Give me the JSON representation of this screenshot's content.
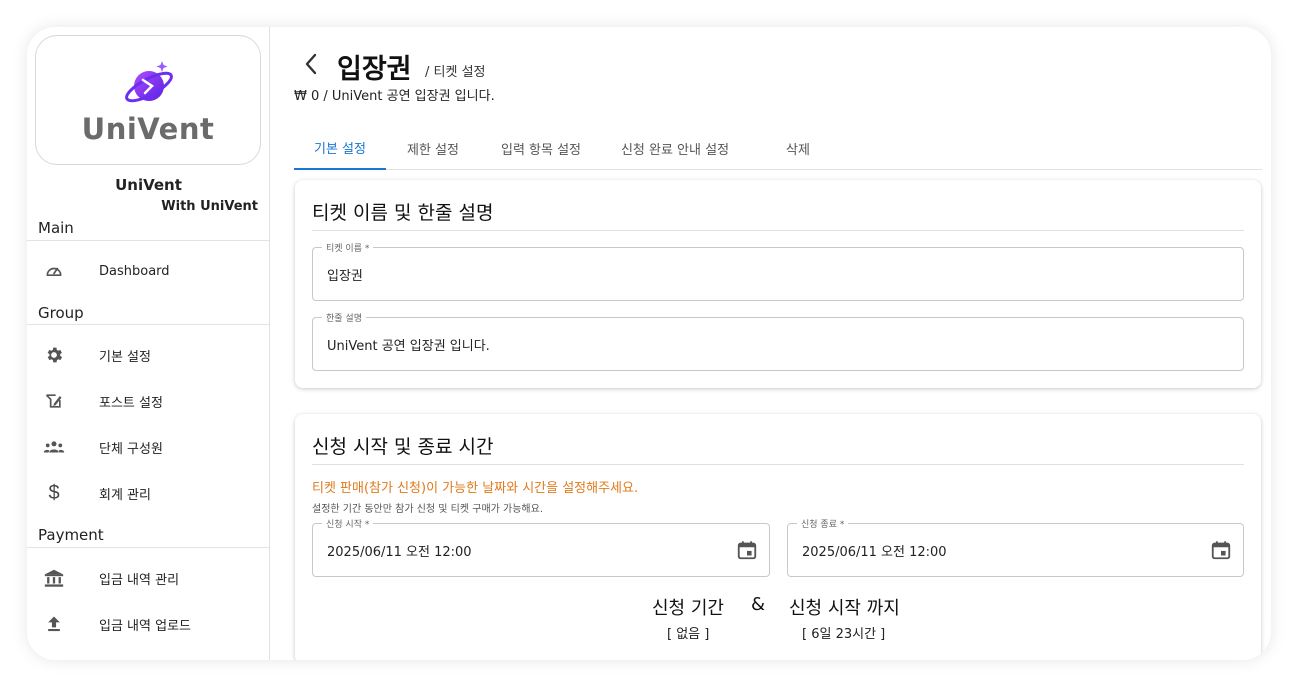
{
  "brand": {
    "logo_text": "UniVent",
    "name": "UniVent",
    "sub": "With UniVent"
  },
  "sidebar": {
    "sections": [
      {
        "label": "Main"
      },
      {
        "label": "Group"
      },
      {
        "label": "Payment"
      }
    ],
    "items": [
      {
        "label": "Dashboard",
        "icon": "speedometer-icon"
      },
      {
        "label": "기본 설정",
        "icon": "gear-icon"
      },
      {
        "label": "포스트 설정",
        "icon": "post-edit-icon"
      },
      {
        "label": "단체 구성원",
        "icon": "group-icon"
      },
      {
        "label": "회계 관리",
        "icon": "dollar-icon"
      },
      {
        "label": "입금 내역 관리",
        "icon": "bank-icon"
      },
      {
        "label": "입금 내역 업로드",
        "icon": "upload-icon"
      }
    ]
  },
  "header": {
    "title": "입장권",
    "subtitle": "/ 티켓 설정",
    "description": "₩ 0 / UniVent 공연 입장권 입니다."
  },
  "tabs": [
    {
      "label": "기본 설정",
      "active": true
    },
    {
      "label": "제한 설정",
      "active": false
    },
    {
      "label": "입력 항목 설정",
      "active": false
    },
    {
      "label": "신청 완료 안내 설정",
      "active": false
    },
    {
      "label": "삭제",
      "active": false
    }
  ],
  "card_name": {
    "title": "티켓 이름 및 한줄 설명",
    "name_field": {
      "label": "티켓 이름 *",
      "value": "입장권"
    },
    "desc_field": {
      "label": "한줄 설명",
      "value": "UniVent 공연 입장권 입니다."
    }
  },
  "card_time": {
    "title": "신청 시작 및 종료 시간",
    "warning": "티켓 판매(참가 신청)이 가능한 날짜와 시간을 설정해주세요.",
    "hint": "설정한 기간 동안만 참가 신청 및 티켓 구매가 가능해요.",
    "start_field": {
      "label": "신청 시작 *",
      "value": "2025/06/11 오전 12:00"
    },
    "end_field": {
      "label": "신청 종료 *",
      "value": "2025/06/11 오전 12:00"
    },
    "period_label": "신청 기간",
    "period_value": "[ 없음 ]",
    "ampersand": "&",
    "until_label": "신청 시작 까지",
    "until_value": "[ 6일 23시간 ]"
  },
  "colors": {
    "accent": "#1976d2",
    "warning": "#e07a1a",
    "logo_purple": "#7b2ff7"
  }
}
